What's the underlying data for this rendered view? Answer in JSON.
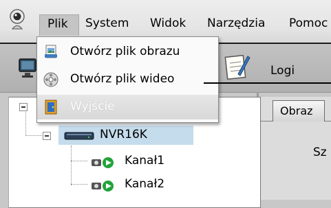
{
  "menubar": {
    "items": [
      {
        "label": "Plik"
      },
      {
        "label": "System"
      },
      {
        "label": "Widok"
      },
      {
        "label": "Narzędzia"
      },
      {
        "label": "Pomoc"
      }
    ]
  },
  "toolbar": {
    "logs_label": "Logi"
  },
  "file_menu": {
    "items": [
      {
        "label": "Otwórz plik obrazu",
        "icon": "image-file-icon",
        "enabled": true
      },
      {
        "label": "Otwórz plik wideo",
        "icon": "video-file-icon",
        "enabled": true
      },
      {
        "label": "Wyjście",
        "icon": "exit-icon",
        "enabled": false
      }
    ]
  },
  "tree": {
    "device": "NVR16K",
    "channels": [
      "Kanał1",
      "Kanał2"
    ]
  },
  "right_panel": {
    "tab_label": "Obraz",
    "partial_text": "Sz"
  },
  "colors": {
    "selection": "#c5dcec",
    "channel_green": "#22a33a"
  }
}
